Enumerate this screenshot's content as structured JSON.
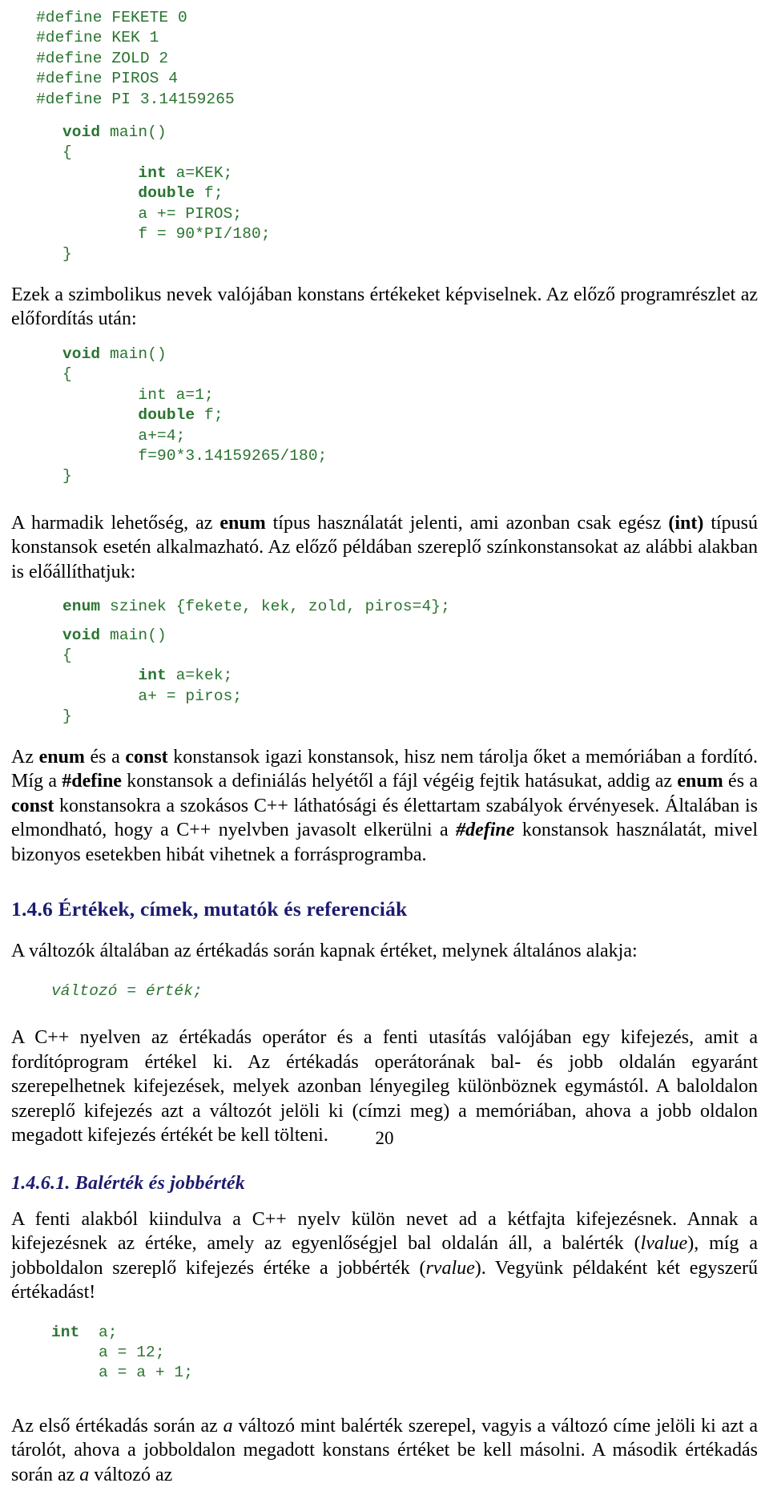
{
  "page": {
    "number": "20",
    "language": "hu",
    "colors": {
      "code_green": "#2a7430",
      "heading_navy": "#1b1b6f",
      "body_black": "#000000",
      "background": "#ffffff"
    }
  },
  "code_block_1": {
    "lines": [
      "#define FEKETE 0",
      "#define KEK 1",
      "#define ZOLD 2",
      "#define PIROS 4",
      "#define PI 3.14159265"
    ],
    "body_lines": [
      "void main()",
      "{",
      "        int a=KEK;",
      "        double f;",
      "        a += PIROS;",
      "        f = 90*PI/180;",
      "}"
    ],
    "keywords": [
      "void",
      "int",
      "double"
    ]
  },
  "paragraph_1": {
    "full_text": "Ezek a szimbolikus nevek valójában konstans értékeket képviselnek. Az előző programrészlet az előfordítás után:"
  },
  "code_block_2": {
    "lines": [
      "void main()",
      "{",
      "        int a=1;",
      "        double f;",
      "        a+=4;",
      "        f=90*3.14159265/180;",
      "}"
    ],
    "keywords": [
      "void",
      "double"
    ]
  },
  "paragraph_2": {
    "part_1": "A harmadik lehetőség, az ",
    "bold_1": "enum",
    "part_2": " típus használatát jelenti, ami azonban csak egész ",
    "bold_2": "(int)",
    "part_3": " típusú konstansok esetén alkalmazható. Az előző példában szereplő színkonstansokat az alábbi alakban is előállíthatjuk:"
  },
  "code_block_3": {
    "declaration": "enum szinek {fekete, kek, zold, piros=4};",
    "lines": [
      "void main()",
      "{",
      "        int a=kek;",
      "        a+ = piros;",
      "}"
    ],
    "keywords": [
      "enum",
      "void",
      "int"
    ]
  },
  "paragraph_3": {
    "part_1": "Az ",
    "bold_1": "enum",
    "part_2": " és a ",
    "bold_2": "const",
    "part_3": " konstansok igazi konstansok, hisz nem tárolja őket a memóriában a fordító. Míg a ",
    "bold_3": "#define",
    "part_4": " konstansok a definiálás helyétől a fájl végéig fejtik hatásukat, addig az ",
    "bold_4": "enum",
    "part_5": " és a ",
    "bold_5": "const",
    "part_6": " konstansokra a szokásos C++ láthatósági és élettartam szabályok érvényesek. Általában is elmondható, hogy a C++ nyelvben javasolt elkerülni a ",
    "bolditalic_1": "#define",
    "part_7": " konstansok használatát, mivel bizonyos esetekben hibát vihetnek a forrásprogramba."
  },
  "heading_1": {
    "text": "1.4.6 Értékek, címek, mutatók és referenciák"
  },
  "paragraph_4": {
    "full_text": "A változók általában az értékadás során kapnak értéket, melynek általános alakja:"
  },
  "code_block_4": {
    "line": "változó = érték;"
  },
  "paragraph_5": {
    "full_text": "A C++ nyelven az értékadás operátor és a fenti utasítás valójában egy kifejezés, amit a fordítóprogram értékel ki. Az értékadás operátorának bal- és jobb oldalán egyaránt szerepelhetnek kifejezések, melyek azonban lényegileg különböznek egymástól. A baloldalon szereplő kifejezés azt a változót jelöli ki (címzi meg) a memóriában, ahova a jobb oldalon megadott kifejezés értékét be kell tölteni."
  },
  "heading_2": {
    "text": "1.4.6.1. Balérték és jobbérték"
  },
  "paragraph_6": {
    "part_1": "A fenti alakból kiindulva a C++ nyelv külön nevet ad a kétfajta kifejezésnek. Annak a kifejezésnek az értéke, amely az egyenlőségjel bal oldalán áll, a balérték (",
    "italic_1": "lvalue",
    "part_2": "), míg a jobboldalon szereplő kifejezés értéke a jobbérték (",
    "italic_2": "rvalue",
    "part_3": "). Vegyünk példaként két egyszerű értékadást!"
  },
  "code_block_5": {
    "lines": [
      "int  a;",
      "     a = 12;",
      "     a = a + 1;"
    ],
    "keywords": [
      "int"
    ]
  },
  "paragraph_7": {
    "part_1": "Az első értékadás során az ",
    "italic_1": "a",
    "part_2": " változó mint balérték szerepel, vagyis a változó címe jelöli ki azt a tárolót, ahova a jobboldalon megadott konstans értéket be kell másolni. A második értékadás során az ",
    "italic_2": "a",
    "part_3": " változó az"
  }
}
